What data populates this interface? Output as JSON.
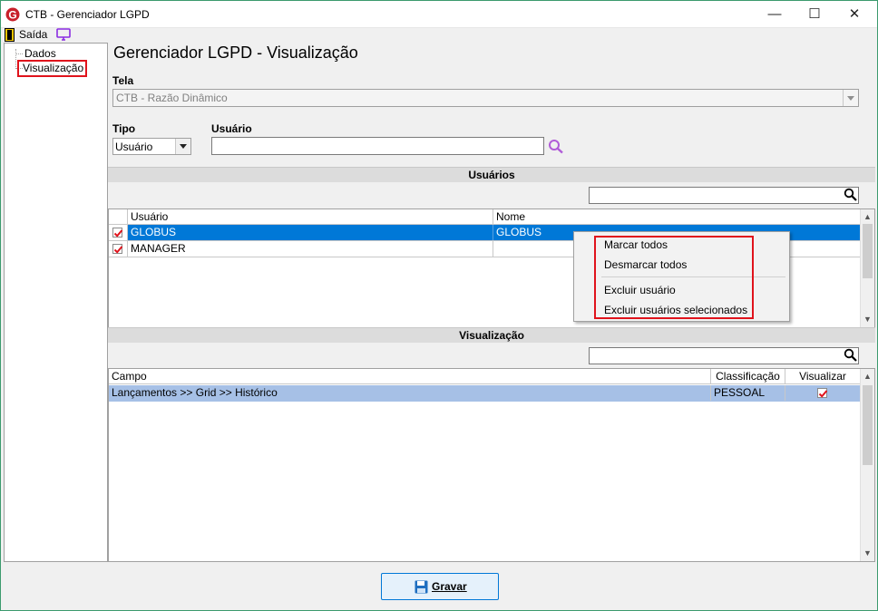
{
  "window": {
    "title": "CTB - Gerenciador LGPD",
    "minimize": "—",
    "maximize": "☐",
    "close": "✕"
  },
  "menubar": {
    "exit_label": "Saída"
  },
  "sidebar": {
    "items": [
      {
        "label": "Dados"
      },
      {
        "label": "Visualização"
      }
    ]
  },
  "main": {
    "title": "Gerenciador LGPD - Visualização",
    "screen_label": "Tela",
    "screen_value": "CTB - Razão Dinâmico",
    "type_label": "Tipo",
    "type_value": "Usuário",
    "user_label": "Usuário",
    "user_value": ""
  },
  "users_section": {
    "header": "Usuários",
    "filter_value": "",
    "columns": [
      "Usuário",
      "Nome"
    ],
    "rows": [
      {
        "checked": true,
        "user": "GLOBUS",
        "name": "GLOBUS",
        "selected": true
      },
      {
        "checked": true,
        "user": "MANAGER",
        "name": "",
        "selected": false
      }
    ]
  },
  "context_menu": {
    "items": [
      "Marcar todos",
      "Desmarcar todos",
      "Excluir usuário",
      "Excluir usuários selecionados"
    ]
  },
  "view_section": {
    "header": "Visualização",
    "filter_value": "",
    "columns": [
      "Campo",
      "Classificação",
      "Visualizar"
    ],
    "rows": [
      {
        "field": "Lançamentos >> Grid >> Histórico",
        "classification": "PESSOAL",
        "visualize": true
      }
    ]
  },
  "footer": {
    "save_label": "Gravar"
  },
  "colors": {
    "selection": "#0078d7",
    "row_highlight": "#a6c0e6",
    "accent_red": "#e0131c",
    "window_border": "#3c9a6e"
  }
}
